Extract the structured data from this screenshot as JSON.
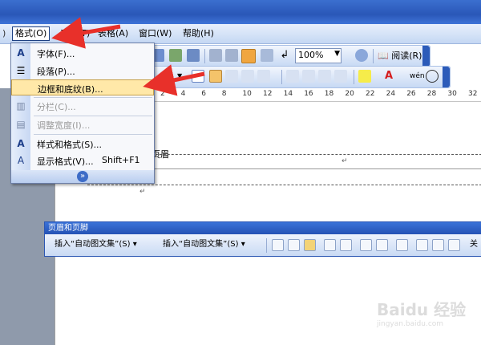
{
  "menubar": {
    "items": [
      {
        "label": "格式(O)",
        "active": true
      },
      {
        "label": "工具(T)"
      },
      {
        "label": "表格(A)"
      },
      {
        "label": "窗口(W)"
      },
      {
        "label": "帮助(H)"
      }
    ]
  },
  "toolbar_standard": {
    "zoom": "100%",
    "read_label": "阅读(R)"
  },
  "ruler": {
    "ticks": [
      "2",
      "4",
      "6",
      "8",
      "10",
      "12",
      "14",
      "16",
      "18",
      "20",
      "22",
      "24",
      "26",
      "28",
      "30",
      "32"
    ]
  },
  "format_menu": {
    "items": [
      {
        "label": "字体(F)...",
        "icon": "font-icon"
      },
      {
        "label": "段落(P)...",
        "icon": "paragraph-icon"
      },
      {
        "label": "边框和底纹(B)...",
        "highlighted": true
      },
      {
        "label": "分栏(C)...",
        "disabled": true,
        "icon": "columns-icon"
      },
      {
        "label": "调整宽度(I)...",
        "disabled": true,
        "icon": "fit-width-icon"
      },
      {
        "label": "样式和格式(S)...",
        "icon": "styles-icon"
      },
      {
        "label": "显示格式(V)...",
        "shortcut": "Shift+F1",
        "icon": "reveal-format-icon"
      }
    ],
    "expand_glyph": "»"
  },
  "document": {
    "header_text": "页眉",
    "para_mark": "↵"
  },
  "header_footer_toolbar": {
    "title": "页眉和页脚",
    "insert_autotext_1": "插入“自动图文集”(S)",
    "insert_autotext_2": "插入“自动图文集”(S)",
    "close_label": "关"
  },
  "watermark": {
    "brand": "Baidu 经验",
    "url": "jingyan.baidu.com"
  },
  "colors": {
    "arrow": "#e8302a",
    "menu_highlight": "#ffe8a8",
    "toolbar_blue": "#2b56b3"
  }
}
